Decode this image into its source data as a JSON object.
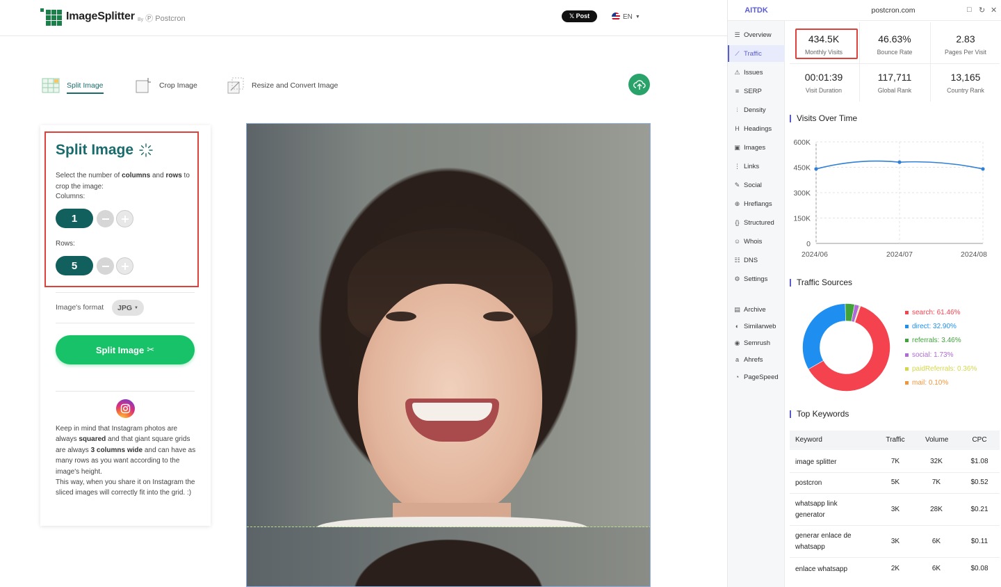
{
  "header": {
    "logo_title": "ImageSplitter",
    "logo_by": "By",
    "logo_brand": "Postcron",
    "x_post_label": "𝕏 Post",
    "language": "EN"
  },
  "tabs": [
    {
      "label": "Split Image"
    },
    {
      "label": "Crop Image"
    },
    {
      "label": "Resize and Convert Image"
    }
  ],
  "split_panel": {
    "title": "Split Image",
    "desc_1": "Select the number of ",
    "desc_columns": "columns",
    "desc_and": " and ",
    "desc_rows": "rows",
    "desc_2": " to crop the image:",
    "columns_label": "Columns:",
    "columns_value": "1",
    "rows_label": "Rows:",
    "rows_value": "5",
    "format_label": "Image's format",
    "format_value": "JPG",
    "split_button": "Split Image",
    "note_1": "Keep in mind that Instagram photos are always ",
    "note_squared": "squared",
    "note_2": " and that giant square grids are always ",
    "note_3cols": "3 columns wide",
    "note_3": " and can have as many rows as you want according to the image's height.",
    "note_4": "This way, when you share it on Instagram the sliced images will correctly fit into the grid. :)"
  },
  "ext": {
    "brand": "AITDK",
    "domain": "postcron.com",
    "nav": [
      {
        "label": "Overview",
        "icon": "overview-icon"
      },
      {
        "label": "Traffic",
        "icon": "traffic-icon"
      },
      {
        "label": "Issues",
        "icon": "warning-icon"
      },
      {
        "label": "SERP",
        "icon": "serp-icon"
      },
      {
        "label": "Density",
        "icon": "density-icon"
      },
      {
        "label": "Headings",
        "icon": "heading-icon"
      },
      {
        "label": "Images",
        "icon": "image-icon"
      },
      {
        "label": "Links",
        "icon": "list-icon"
      },
      {
        "label": "Social",
        "icon": "bird-icon"
      },
      {
        "label": "Hreflangs",
        "icon": "globe-icon"
      },
      {
        "label": "Structured",
        "icon": "braces-icon"
      },
      {
        "label": "Whois",
        "icon": "user-icon"
      },
      {
        "label": "DNS",
        "icon": "server-icon"
      },
      {
        "label": "Settings",
        "icon": "gear-icon"
      },
      {
        "label": "Archive",
        "icon": "archive-icon"
      },
      {
        "label": "Similarweb",
        "icon": "similarweb-icon"
      },
      {
        "label": "Semrush",
        "icon": "semrush-icon"
      },
      {
        "label": "Ahrefs",
        "icon": "ahrefs-icon"
      },
      {
        "label": "PageSpeed",
        "icon": "speed-icon"
      }
    ],
    "metrics": [
      {
        "value": "434.5K",
        "label": "Monthly Visits"
      },
      {
        "value": "46.63%",
        "label": "Bounce Rate"
      },
      {
        "value": "2.83",
        "label": "Pages Per Visit"
      },
      {
        "value": "00:01:39",
        "label": "Visit Duration"
      },
      {
        "value": "117,711",
        "label": "Global Rank"
      },
      {
        "value": "13,165",
        "label": "Country Rank"
      }
    ],
    "visits_title": "Visits Over Time",
    "sources_title": "Traffic Sources",
    "keywords_title": "Top Keywords",
    "keywords_headers": [
      "Keyword",
      "Traffic",
      "Volume",
      "CPC"
    ],
    "keywords": [
      {
        "keyword": "image splitter",
        "traffic": "7K",
        "volume": "32K",
        "cpc": "$1.08"
      },
      {
        "keyword": "postcron",
        "traffic": "5K",
        "volume": "7K",
        "cpc": "$0.52"
      },
      {
        "keyword": "whatsapp link generator",
        "traffic": "3K",
        "volume": "28K",
        "cpc": "$0.21"
      },
      {
        "keyword": "generar enlace de whatsapp",
        "traffic": "3K",
        "volume": "6K",
        "cpc": "$0.11"
      },
      {
        "keyword": "enlace whatsapp",
        "traffic": "2K",
        "volume": "6K",
        "cpc": "$0.08"
      }
    ]
  },
  "colors": {
    "teal": "#1a6b6b",
    "green_button": "#17c268",
    "accent": "#5a5ccc",
    "highlight": "#e0403a"
  },
  "chart_data": [
    {
      "type": "line",
      "title": "Visits Over Time",
      "x": [
        "2024/06",
        "2024/07",
        "2024/08"
      ],
      "y_ticks": [
        "600K",
        "450K",
        "300K",
        "150K",
        "0"
      ],
      "ylim": [
        0,
        600000
      ],
      "series": [
        {
          "values": [
            440000,
            480000,
            440000
          ]
        }
      ],
      "grid": true
    },
    {
      "type": "pie",
      "title": "Traffic Sources",
      "slices": [
        {
          "label": "search: 61.46%",
          "value": 61.46,
          "color": "#f5424f"
        },
        {
          "label": "direct: 32.90%",
          "value": 32.9,
          "color": "#1e8ff0"
        },
        {
          "label": "referrals: 3.46%",
          "value": 3.46,
          "color": "#3fa33a"
        },
        {
          "label": "social: 1.73%",
          "value": 1.73,
          "color": "#b06ad8"
        },
        {
          "label": "paidReferrals: 0.36%",
          "value": 0.36,
          "color": "#d3d84a"
        },
        {
          "label": "mail: 0.10%",
          "value": 0.1,
          "color": "#f2953a"
        }
      ],
      "legend": "right"
    }
  ]
}
